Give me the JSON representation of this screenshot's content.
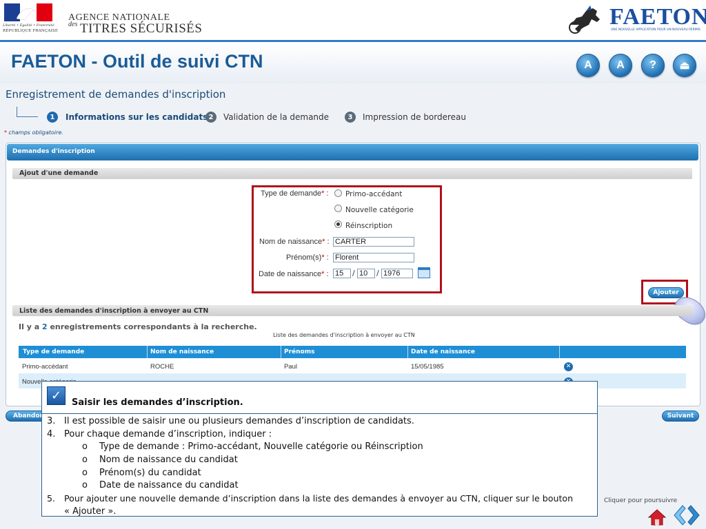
{
  "header": {
    "rf_line1": "Liberté • Égalité • Fraternité",
    "rf_line2": "RÉPUBLIQUE FRANÇAISE",
    "agency_line1": "AGENCE NATIONALE",
    "agency_des": "des",
    "agency_line2": "TITRES SÉCURISÉS",
    "faeton_word": "FAETON",
    "faeton_sub": "UNE NOUVELLE APPLICATION POUR UN NOUVEAU PERMIS"
  },
  "app": {
    "title": "FAETON - Outil de suivi CTN",
    "icons": [
      "text-decrease-icon",
      "text-increase-icon",
      "help-icon",
      "logout-icon"
    ],
    "icon_labels": [
      "A",
      "A",
      "?",
      "⏏"
    ]
  },
  "page": {
    "heading": "Enregistrement de demandes d'inscription",
    "steps": [
      {
        "num": "1",
        "label": "Informations sur les candidats"
      },
      {
        "num": "2",
        "label": "Validation de la demande"
      },
      {
        "num": "3",
        "label": "Impression de bordereau"
      }
    ],
    "required_note": "champs obligatoire."
  },
  "panel": {
    "title": "Demandes d'inscription",
    "form_title": "Ajout d'une demande",
    "type_label": "Type de demande",
    "type_options": [
      "Primo-accédant",
      "Nouvelle catégorie",
      "Réinscription"
    ],
    "type_selected": "Réinscription",
    "nom_label": "Nom de naissance",
    "nom_value": "CARTER",
    "prenom_label": "Prénom(s)",
    "prenom_value": "Florent",
    "date_label": "Date de naissance",
    "date_day": "15",
    "date_month": "10",
    "date_year": "1976",
    "add_button": "Ajouter",
    "list_title": "Liste des demandes d'inscription à envoyer au CTN",
    "count_prefix": "Il y a",
    "count_value": "2",
    "count_suffix": "enregistrements correspondants à la recherche.",
    "table_caption": "Liste des demandes d'inscription à envoyer au CTN",
    "columns": [
      "Type de demande",
      "Nom de naissance",
      "Prénoms",
      "Date de naissance"
    ],
    "rows": [
      {
        "type": "Primo-accédant",
        "nom": "ROCHE",
        "prenom": "Paul",
        "date": "15/05/1985"
      },
      {
        "type": "Nouvelle catégorie",
        "nom": "",
        "prenom": "",
        "date": ""
      }
    ]
  },
  "nav": {
    "abandon": "Abandon",
    "next": "Suivant"
  },
  "callout": {
    "title": "Saisir les  demandes d’inscription.",
    "items": [
      {
        "num": "3.",
        "text": "Il est possible de saisir une ou plusieurs demandes d’inscription de candidats."
      },
      {
        "num": "4.",
        "text": "Pour chaque demande d’inscription, indiquer :"
      }
    ],
    "subitems": [
      "Type de demande : Primo-accédant, Nouvelle catégorie ou  Réinscription",
      "Nom de naissance du candidat",
      "Prénom(s) du candidat",
      "Date de naissance du candidat"
    ],
    "subbullet": "o",
    "item5_num": "5.",
    "item5_text_line1": "Pour ajouter  une nouvelle demande d’inscription dans la liste des demandes à envoyer au CTN, cliquer sur le bouton",
    "item5_text_line2": "« Ajouter ».",
    "continue_label": "Cliquer pour poursuivre"
  },
  "colors": {
    "title_blue": "#1b5b97",
    "highlight_red": "#b0101a",
    "table_header": "#1e8fd5"
  }
}
